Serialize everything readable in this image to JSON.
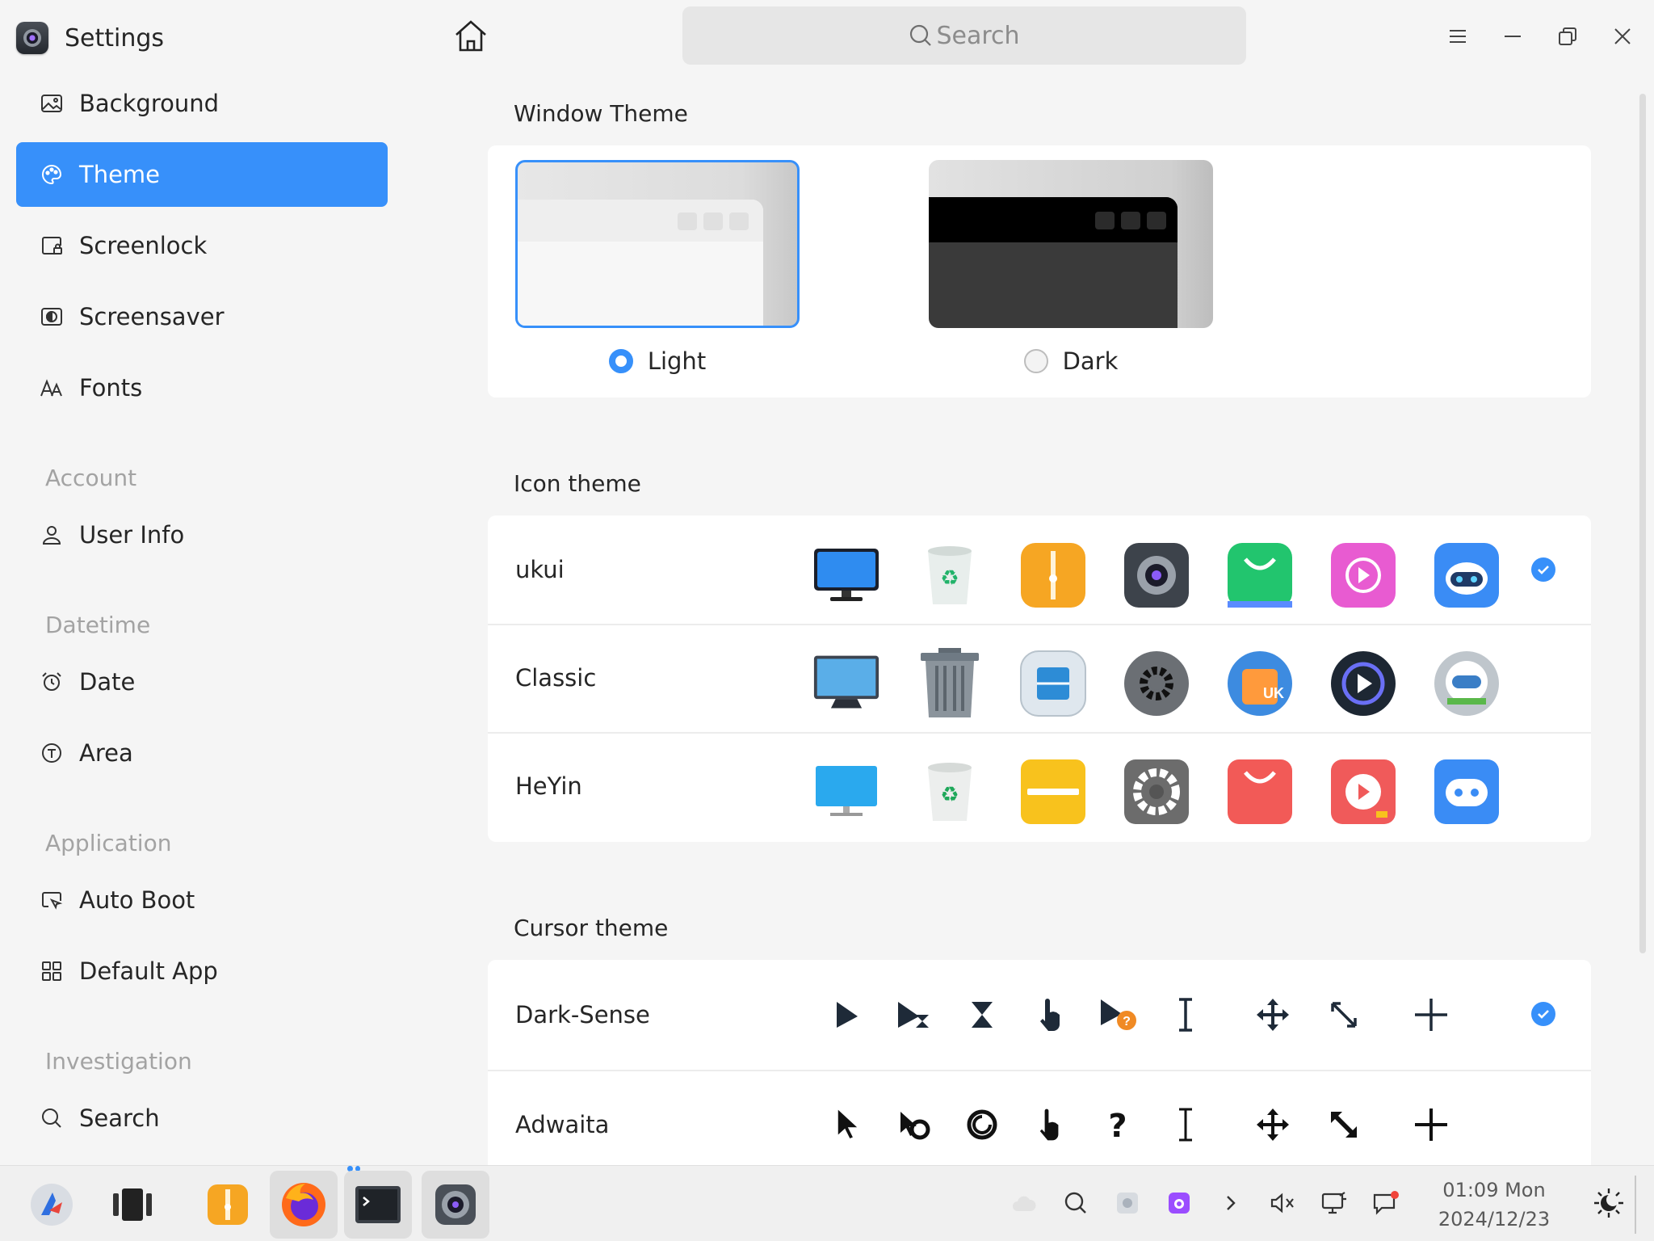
{
  "app": {
    "title": "Settings"
  },
  "sidebar": {
    "items": [
      {
        "label": "Background",
        "icon": "background-icon"
      },
      {
        "label": "Theme",
        "icon": "theme-icon",
        "active": true
      },
      {
        "label": "Screenlock",
        "icon": "screenlock-icon"
      },
      {
        "label": "Screensaver",
        "icon": "screensaver-icon"
      },
      {
        "label": "Fonts",
        "icon": "fonts-icon"
      },
      {
        "label": "User Info",
        "icon": "user-icon"
      },
      {
        "label": "Date",
        "icon": "alarm-clock-icon"
      },
      {
        "label": "Area",
        "icon": "area-icon"
      },
      {
        "label": "Auto Boot",
        "icon": "auto-boot-icon"
      },
      {
        "label": "Default App",
        "icon": "grid-icon"
      },
      {
        "label": "Search",
        "icon": "search-icon"
      }
    ],
    "groups": [
      "Account",
      "Datetime",
      "Application",
      "Investigation"
    ]
  },
  "search": {
    "placeholder": "Search"
  },
  "window_theme": {
    "title": "Window Theme",
    "options": [
      {
        "label": "Light",
        "selected": true
      },
      {
        "label": "Dark",
        "selected": false
      }
    ]
  },
  "icon_theme": {
    "title": "Icon theme",
    "themes": [
      {
        "name": "ukui",
        "selected": true
      },
      {
        "name": "Classic",
        "selected": false
      },
      {
        "name": "HeYin",
        "selected": false
      }
    ]
  },
  "cursor_theme": {
    "title": "Cursor theme",
    "themes": [
      {
        "name": "Dark-Sense",
        "selected": true
      },
      {
        "name": "Adwaita",
        "selected": false
      }
    ]
  },
  "taskbar": {
    "clock_time": "01:09 Mon",
    "clock_date": "2024/12/23"
  },
  "colors": {
    "accent": "#3790fa",
    "sidebar_bg": "#f5f5f5",
    "card_bg": "#ffffff"
  }
}
